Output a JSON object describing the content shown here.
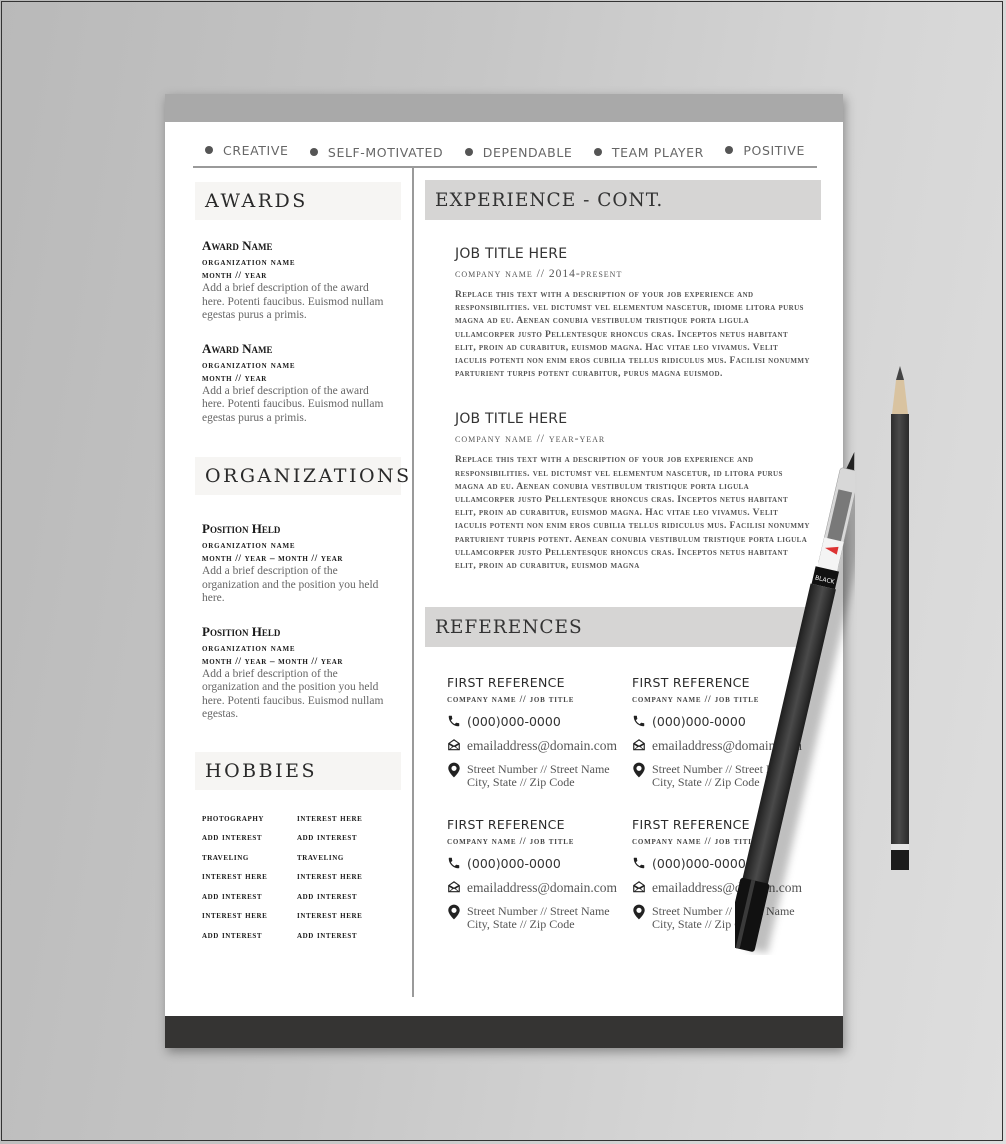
{
  "traits": [
    "CREATIVE",
    "SELF-MOTIVATED",
    "DEPENDABLE",
    "TEAM PLAYER",
    "POSITIVE"
  ],
  "awards": {
    "heading": "AWARDS",
    "items": [
      {
        "title": "Award Name",
        "org": "ORGANIZATION NAME",
        "date": "MONTH // YEAR",
        "desc": "Add a brief description of the award here. Potenti faucibus. Euismod nullam egestas purus a primis."
      },
      {
        "title": "Award Name",
        "org": "ORGANIZATION NAME",
        "date": "MONTH // YEAR",
        "desc": "Add a brief description of the award here. Potenti faucibus. Euismod nullam egestas purus a primis."
      }
    ]
  },
  "organizations": {
    "heading": "ORGANIZATIONS",
    "items": [
      {
        "title": "Position Held",
        "org": "ORGANIZATION NAME",
        "date": "MONTH // YEAR – MONTH // YEAR",
        "desc": "Add a brief description of the organization and the position you held here."
      },
      {
        "title": "Position Held",
        "org": "ORGANIZATION NAME",
        "date": "MONTH // YEAR – MONTH // YEAR",
        "desc": "Add a brief description of the organization and the position you held here. Potenti faucibus. Euismod nullam egestas."
      }
    ]
  },
  "hobbies": {
    "heading": "HOBBIES",
    "items": [
      "PHOTOGRAPHY",
      "INTEREST HERE",
      "ADD INTEREST",
      "ADD INTEREST",
      "TRAVELING",
      "TRAVELING",
      "INTEREST HERE",
      "INTEREST HERE",
      "ADD INTEREST",
      "ADD INTEREST",
      "INTEREST HERE",
      "INTEREST HERE",
      "ADD INTEREST",
      "ADD INTEREST"
    ]
  },
  "experience": {
    "heading": "EXPERIENCE - CONT.",
    "jobs": [
      {
        "title": "JOB TITLE HERE",
        "company": "COMPANY NAME // 2014-PRESENT",
        "desc": "Replace this text with a description of your job experience and responsibilities. vel dictumst vel elementum nascetur, idiome litora purus magna ad eu. Aenean conubia vestibulum tristique porta ligula ullamcorper justo Pellentesque rhoncus cras. Inceptos netus habitant elit, proin ad curabitur, euismod magna. Hac vitae leo vivamus. Velit iaculis potenti non enim eros cubilia tellus ridiculus mus. Facilisi nonummy parturient turpis potent curabitur, purus magna euismod."
      },
      {
        "title": "JOB TITLE HERE",
        "company": "COMPANY NAME // YEAR-YEAR",
        "desc": "Replace this text with a description of your job experience and responsibilities. vel dictumst vel elementum nascetur, id litora purus magna ad eu. Aenean conubia vestibulum tristique porta ligula ullamcorper justo Pellentesque rhoncus cras. Inceptos netus habitant elit, proin ad curabitur, euismod magna. Hac vitae leo vivamus. Velit iaculis potenti non enim eros cubilia tellus ridiculus mus. Facilisi nonummy parturient turpis potent. Aenean conubia vestibulum tristique porta ligula ullamcorper justo Pellentesque rhoncus cras. Inceptos netus habitant elit, proin ad curabitur, euismod magna"
      }
    ]
  },
  "references": {
    "heading": "REFERENCES",
    "items": [
      {
        "name": "FIRST REFERENCE",
        "company": "COMPANY NAME // JOB TITLE",
        "phone": "(000)000-0000",
        "email": "emailaddress@domain.com",
        "addr1": "Street Number // Street Name",
        "addr2": "City, State // Zip Code"
      },
      {
        "name": "FIRST REFERENCE",
        "company": "COMPANY NAME // JOB TITLE",
        "phone": "(000)000-0000",
        "email": "emailaddress@domain.com",
        "addr1": "Street Number // Street Name",
        "addr2": "City, State // Zip Code"
      },
      {
        "name": "FIRST REFERENCE",
        "company": "COMPANY NAME // JOB TITLE",
        "phone": "(000)000-0000",
        "email": "emailaddress@domain.com",
        "addr1": "Street Number // Street Name",
        "addr2": "City, State // Zip Code"
      },
      {
        "name": "FIRST REFERENCE",
        "company": "COMPANY NAME // JOB TITLE",
        "phone": "(000)000-0000",
        "email": "emailaddress@domain.com",
        "addr1": "Street Number // Street Name",
        "addr2": "City, State // Zip Code"
      }
    ]
  },
  "props": {
    "pen_label": "BLACK"
  },
  "colors": {
    "top_band": "#a9a9a9",
    "bottom_band": "#353433",
    "section_bar": "#d6d5d4",
    "left_heading_bg": "#f6f5f3"
  }
}
